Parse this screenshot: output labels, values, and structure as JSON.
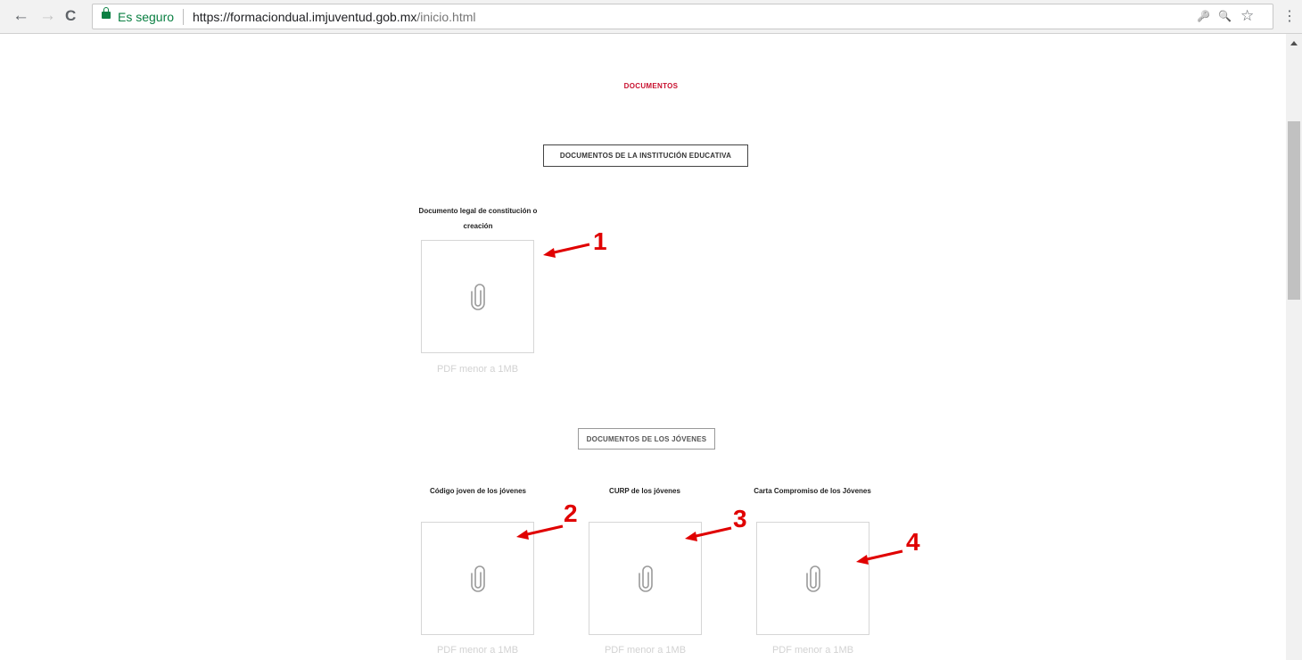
{
  "browser": {
    "back_icon": "←",
    "forward_icon": "→",
    "reload_icon": "C",
    "secure_label": "Es seguro",
    "url_host": "https://formaciondual.imjuventud.gob.mx",
    "url_path": "/inicio.html",
    "key_icon": "🔑",
    "zoom_icon": "🔍",
    "star_icon": "☆",
    "menu_icon": "⋮"
  },
  "page": {
    "heading": "DOCUMENTOS",
    "institution": {
      "button_label": "DOCUMENTOS DE LA INSTITUCIÓN EDUCATIVA",
      "documents": [
        {
          "label": "Documento legal de constitución o creación",
          "hint": "PDF menor a 1MB"
        }
      ]
    },
    "youth": {
      "button_label": "DOCUMENTOS DE LOS JÓVENES",
      "documents": [
        {
          "label": "Código joven de los jóvenes",
          "hint": "PDF menor a 1MB"
        },
        {
          "label": "CURP de los jóvenes",
          "hint": "PDF menor a 1MB"
        },
        {
          "label": "Carta Compromiso de los Jóvenes",
          "hint": "PDF menor a 1MB"
        }
      ]
    }
  },
  "annotations": [
    "1",
    "2",
    "3",
    "4"
  ],
  "colors": {
    "heading_red": "#c8102e",
    "annotation_red": "#e00000",
    "secure_green": "#0b8043"
  }
}
